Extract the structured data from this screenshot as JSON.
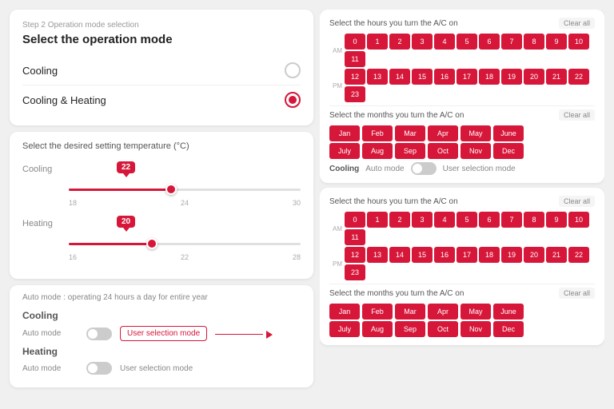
{
  "left": {
    "step_label": "Step 2  Operation mode selection",
    "title": "Select the operation mode",
    "options": [
      {
        "label": "Cooling",
        "selected": false
      },
      {
        "label": "Cooling & Heating",
        "selected": true
      }
    ],
    "temp_card_title": "Select the desired setting temperature (°C)",
    "cooling_slider": {
      "label": "Cooling",
      "value": 22,
      "min": 18,
      "mid": 24,
      "max": 30,
      "fill_pct": 44
    },
    "heating_slider": {
      "label": "Heating",
      "value": 20,
      "min": 16,
      "mid": 22,
      "max": 28,
      "fill_pct": 36
    },
    "auto_card_title": "Auto mode : operating 24 hours a day for entire year",
    "cooling_section": "Cooling",
    "heating_section": "Heating",
    "auto_mode_label": "Auto mode",
    "user_selection_label": "User selection mode",
    "arrow": "→"
  },
  "right": {
    "section1_title": "Select the hours you turn the A/C on",
    "clear_all": "Clear all",
    "am_label": "AM",
    "pm_label": "PM",
    "am_hours": [
      "0",
      "1",
      "2",
      "3",
      "4",
      "5",
      "6",
      "7",
      "8",
      "9",
      "10",
      "11"
    ],
    "pm_hours": [
      "12",
      "13",
      "14",
      "15",
      "16",
      "17",
      "18",
      "19",
      "20",
      "21",
      "22",
      "23"
    ],
    "section2_title": "Select the months you turn the A/C on",
    "clear_all2": "Clear all",
    "months_row1": [
      "Jan",
      "Feb",
      "Mar",
      "Apr",
      "May",
      "June"
    ],
    "months_row2": [
      "July",
      "Aug",
      "Sep",
      "Oct",
      "Nov",
      "Dec"
    ],
    "cooling_mode_label": "Cooling",
    "auto_mode_label2": "Auto mode",
    "user_selection_label2": "User selection mode",
    "section3_title": "Select the hours you turn the A/C on",
    "clear_all3": "Clear all",
    "am_hours2": [
      "0",
      "1",
      "2",
      "3",
      "4",
      "5",
      "6",
      "7",
      "8",
      "9",
      "10",
      "11"
    ],
    "pm_hours2": [
      "12",
      "13",
      "14",
      "15",
      "16",
      "17",
      "18",
      "19",
      "20",
      "21",
      "22",
      "23"
    ],
    "section4_title": "Select the months you turn the A/C on",
    "clear_all4": "Clear all",
    "months2_row1": [
      "Jan",
      "Feb",
      "Mar",
      "Apr",
      "May",
      "June"
    ],
    "months2_row2": [
      "July",
      "Aug",
      "Sep",
      "Oct",
      "Nov",
      "Dec"
    ]
  }
}
